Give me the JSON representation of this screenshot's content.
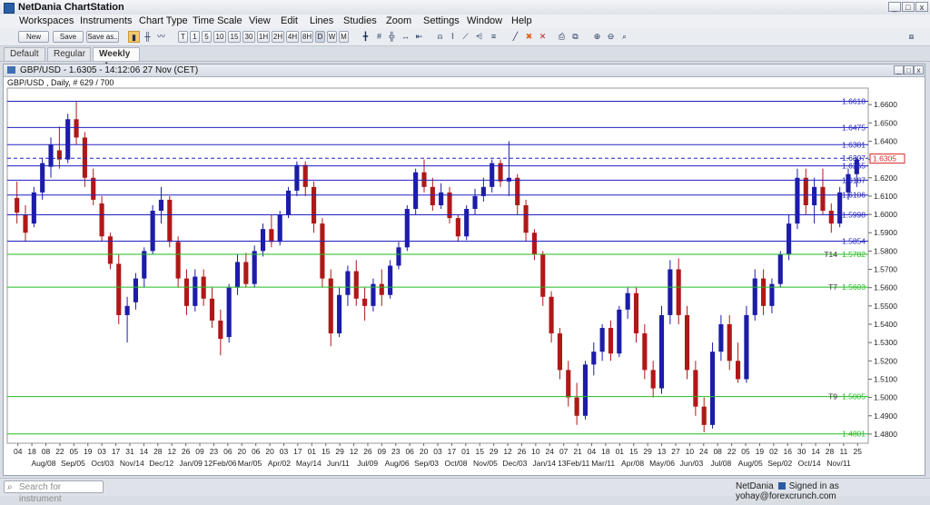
{
  "app": {
    "title": "NetDania ChartStation"
  },
  "window_buttons": [
    "_",
    "□",
    "x"
  ],
  "menu": [
    "Workspaces",
    "Instruments",
    "Chart Type",
    "Time Scale",
    "View",
    "Edit",
    "Lines",
    "Studies",
    "Zoom",
    "Settings",
    "Window",
    "Help"
  ],
  "toolbar": {
    "new_label": "New",
    "save_label": "Save",
    "save_as_label": "Save as..",
    "time_buttons": [
      "T",
      "1",
      "5",
      "10",
      "15",
      "30",
      "1H",
      "2H",
      "4H",
      "8H",
      "D",
      "W",
      "M"
    ]
  },
  "tabs": [
    {
      "label": "Default",
      "active": false
    },
    {
      "label": "Regular",
      "active": false
    },
    {
      "label": "Weekly",
      "active": true,
      "close": "✱"
    }
  ],
  "chart_window": {
    "title": "GBP/USD - 1.6305 - 14:12:06  27 Nov (CET)",
    "subtitle": "GBP/USD , Daily, # 629 / 700",
    "buttons": [
      "_",
      "□",
      "x"
    ]
  },
  "chart_data": {
    "type": "candlestick",
    "symbol": "GBP/USD",
    "interval": "Daily",
    "current_price": "1.6305",
    "current_price_color": "#d62828",
    "ylim": [
      1.475,
      1.669
    ],
    "y_ticks": [
      "1.6600",
      "1.6500",
      "1.6400",
      "1.6300",
      "1.6200",
      "1.6100",
      "1.6000",
      "1.5900",
      "1.5800",
      "1.5700",
      "1.5600",
      "1.5500",
      "1.5400",
      "1.5300",
      "1.5200",
      "1.5100",
      "1.5000",
      "1.4900",
      "1.4800"
    ],
    "x_ticks": [
      "04",
      "18",
      "08",
      "22",
      "05",
      "19",
      "03",
      "17",
      "31",
      "14",
      "28",
      "12",
      "26",
      "09",
      "23",
      "06",
      "20",
      "06",
      "20",
      "03",
      "17",
      "01",
      "15",
      "29",
      "12",
      "26",
      "09",
      "23",
      "06",
      "20",
      "03",
      "17",
      "01",
      "15",
      "29",
      "12",
      "26",
      "10",
      "24",
      "07",
      "21",
      "04",
      "18",
      "01",
      "15",
      "29",
      "13",
      "27",
      "10",
      "24",
      "08",
      "22",
      "05",
      "19",
      "02",
      "16",
      "30",
      "14",
      "28",
      "11",
      "25"
    ],
    "x_months": [
      "Aug/08",
      "Sep/05",
      "Oct/03",
      "Nov/14",
      "Dec/12",
      "Jan/09",
      "12Feb/06",
      "Mar/05",
      "Apr/02",
      "May/14",
      "Jun/11",
      "Jul/09",
      "Aug/06",
      "Sep/03",
      "Oct/08",
      "Nov/05",
      "Dec/03",
      "Jan/14",
      "13Feb/11",
      "Mar/11",
      "Apr/08",
      "May/06",
      "Jun/03",
      "Jul/08",
      "Aug/05",
      "Sep/02",
      "Oct/14",
      "Nov/11"
    ],
    "horizontal_lines": [
      {
        "value": 1.6618,
        "label": "1.6618",
        "color": "#2020c0",
        "style": "solid"
      },
      {
        "value": 1.6475,
        "label": "1.6475",
        "color": "#2020c0",
        "style": "solid"
      },
      {
        "value": 1.6381,
        "label": "1.6381",
        "color": "#2020c0",
        "style": "solid"
      },
      {
        "value": 1.6307,
        "label": "1.6307",
        "color": "#2020c0",
        "style": "dashed"
      },
      {
        "value": 1.6265,
        "label": "1.6265",
        "color": "#2020c0",
        "style": "solid"
      },
      {
        "value": 1.6187,
        "label": "1.6187",
        "color": "#2020c0",
        "style": "solid"
      },
      {
        "value": 1.6106,
        "label": "1.6106",
        "color": "#2020c0",
        "style": "solid"
      },
      {
        "value": 1.5998,
        "label": "1.5998",
        "color": "#2020c0",
        "style": "solid"
      },
      {
        "value": 1.5854,
        "label": "1.5854",
        "color": "#2020c0",
        "style": "solid"
      },
      {
        "value": 1.5782,
        "label": "1.5782",
        "name": "T14",
        "color": "#22bb22",
        "style": "solid"
      },
      {
        "value": 1.5603,
        "label": "1.5603",
        "name": "T7",
        "color": "#22bb22",
        "style": "solid"
      },
      {
        "value": 1.5005,
        "label": "1.5005",
        "name": "T9",
        "color": "#22bb22",
        "style": "solid"
      },
      {
        "value": 1.4801,
        "label": "1.4801",
        "color": "#22bb22",
        "style": "solid"
      }
    ],
    "up_color": "#1c1ca8",
    "down_color": "#b01818",
    "candles": [
      [
        1.609,
        1.618,
        1.595,
        1.601
      ],
      [
        1.6,
        1.605,
        1.585,
        1.59
      ],
      [
        1.595,
        1.615,
        1.593,
        1.612
      ],
      [
        1.612,
        1.631,
        1.608,
        1.628
      ],
      [
        1.626,
        1.642,
        1.62,
        1.638
      ],
      [
        1.635,
        1.648,
        1.625,
        1.63
      ],
      [
        1.63,
        1.655,
        1.628,
        1.652
      ],
      [
        1.652,
        1.662,
        1.638,
        1.642
      ],
      [
        1.642,
        1.645,
        1.615,
        1.62
      ],
      [
        1.62,
        1.625,
        1.605,
        1.608
      ],
      [
        1.606,
        1.61,
        1.585,
        1.588
      ],
      [
        1.588,
        1.59,
        1.57,
        1.573
      ],
      [
        1.573,
        1.578,
        1.54,
        1.545
      ],
      [
        1.545,
        1.555,
        1.53,
        1.55
      ],
      [
        1.552,
        1.568,
        1.548,
        1.565
      ],
      [
        1.565,
        1.582,
        1.56,
        1.58
      ],
      [
        1.58,
        1.605,
        1.578,
        1.602
      ],
      [
        1.602,
        1.615,
        1.595,
        1.608
      ],
      [
        1.608,
        1.61,
        1.582,
        1.585
      ],
      [
        1.585,
        1.588,
        1.56,
        1.565
      ],
      [
        1.565,
        1.57,
        1.545,
        1.55
      ],
      [
        1.55,
        1.57,
        1.547,
        1.566
      ],
      [
        1.566,
        1.57,
        1.55,
        1.554
      ],
      [
        1.554,
        1.56,
        1.538,
        1.542
      ],
      [
        1.542,
        1.548,
        1.523,
        1.532
      ],
      [
        1.533,
        1.562,
        1.53,
        1.56
      ],
      [
        1.56,
        1.578,
        1.556,
        1.574
      ],
      [
        1.574,
        1.579,
        1.56,
        1.562
      ],
      [
        1.562,
        1.583,
        1.56,
        1.58
      ],
      [
        1.58,
        1.595,
        1.577,
        1.592
      ],
      [
        1.592,
        1.6,
        1.582,
        1.585
      ],
      [
        1.585,
        1.602,
        1.583,
        1.6
      ],
      [
        1.6,
        1.615,
        1.598,
        1.613
      ],
      [
        1.613,
        1.629,
        1.61,
        1.627
      ],
      [
        1.627,
        1.629,
        1.61,
        1.615
      ],
      [
        1.615,
        1.618,
        1.59,
        1.595
      ],
      [
        1.595,
        1.598,
        1.56,
        1.565
      ],
      [
        1.565,
        1.57,
        1.528,
        1.535
      ],
      [
        1.535,
        1.56,
        1.533,
        1.556
      ],
      [
        1.556,
        1.572,
        1.55,
        1.569
      ],
      [
        1.569,
        1.575,
        1.55,
        1.554
      ],
      [
        1.554,
        1.56,
        1.542,
        1.55
      ],
      [
        1.55,
        1.565,
        1.547,
        1.562
      ],
      [
        1.562,
        1.57,
        1.55,
        1.556
      ],
      [
        1.556,
        1.575,
        1.554,
        1.572
      ],
      [
        1.572,
        1.585,
        1.57,
        1.582
      ],
      [
        1.582,
        1.605,
        1.58,
        1.603
      ],
      [
        1.603,
        1.625,
        1.6,
        1.623
      ],
      [
        1.623,
        1.63,
        1.612,
        1.615
      ],
      [
        1.615,
        1.62,
        1.602,
        1.605
      ],
      [
        1.605,
        1.617,
        1.603,
        1.612
      ],
      [
        1.612,
        1.615,
        1.595,
        1.598
      ],
      [
        1.598,
        1.6,
        1.585,
        1.588
      ],
      [
        1.588,
        1.605,
        1.586,
        1.603
      ],
      [
        1.603,
        1.614,
        1.6,
        1.61
      ],
      [
        1.61,
        1.62,
        1.607,
        1.615
      ],
      [
        1.615,
        1.63,
        1.612,
        1.628
      ],
      [
        1.628,
        1.63,
        1.615,
        1.618
      ],
      [
        1.618,
        1.64,
        1.61,
        1.62
      ],
      [
        1.62,
        1.622,
        1.6,
        1.605
      ],
      [
        1.605,
        1.608,
        1.585,
        1.59
      ],
      [
        1.59,
        1.592,
        1.575,
        1.578
      ],
      [
        1.578,
        1.58,
        1.55,
        1.555
      ],
      [
        1.555,
        1.558,
        1.53,
        1.535
      ],
      [
        1.535,
        1.538,
        1.51,
        1.515
      ],
      [
        1.515,
        1.52,
        1.495,
        1.5
      ],
      [
        1.5,
        1.508,
        1.485,
        1.49
      ],
      [
        1.49,
        1.52,
        1.488,
        1.518
      ],
      [
        1.518,
        1.53,
        1.512,
        1.525
      ],
      [
        1.525,
        1.54,
        1.52,
        1.538
      ],
      [
        1.538,
        1.542,
        1.52,
        1.524
      ],
      [
        1.524,
        1.55,
        1.522,
        1.548
      ],
      [
        1.548,
        1.56,
        1.543,
        1.557
      ],
      [
        1.557,
        1.56,
        1.53,
        1.535
      ],
      [
        1.535,
        1.54,
        1.51,
        1.515
      ],
      [
        1.515,
        1.52,
        1.5,
        1.505
      ],
      [
        1.505,
        1.55,
        1.502,
        1.545
      ],
      [
        1.545,
        1.575,
        1.54,
        1.57
      ],
      [
        1.57,
        1.576,
        1.54,
        1.545
      ],
      [
        1.545,
        1.55,
        1.51,
        1.515
      ],
      [
        1.515,
        1.52,
        1.49,
        1.495
      ],
      [
        1.495,
        1.5,
        1.481,
        1.485
      ],
      [
        1.485,
        1.53,
        1.483,
        1.525
      ],
      [
        1.525,
        1.545,
        1.52,
        1.54
      ],
      [
        1.54,
        1.545,
        1.515,
        1.52
      ],
      [
        1.52,
        1.53,
        1.508,
        1.51
      ],
      [
        1.51,
        1.55,
        1.508,
        1.545
      ],
      [
        1.545,
        1.57,
        1.542,
        1.565
      ],
      [
        1.565,
        1.57,
        1.545,
        1.55
      ],
      [
        1.55,
        1.565,
        1.546,
        1.562
      ],
      [
        1.562,
        1.58,
        1.56,
        1.578
      ],
      [
        1.578,
        1.6,
        1.575,
        1.595
      ],
      [
        1.595,
        1.625,
        1.592,
        1.62
      ],
      [
        1.62,
        1.625,
        1.6,
        1.605
      ],
      [
        1.605,
        1.62,
        1.595,
        1.615
      ],
      [
        1.615,
        1.625,
        1.6,
        1.602
      ],
      [
        1.602,
        1.606,
        1.59,
        1.595
      ],
      [
        1.595,
        1.615,
        1.593,
        1.612
      ],
      [
        1.612,
        1.625,
        1.608,
        1.622
      ],
      [
        1.622,
        1.631,
        1.615,
        1.63
      ]
    ]
  },
  "statusbar": {
    "search_placeholder": "Search for instrument",
    "brand": "NetDania",
    "signed_in": "Signed in as yohay@forexcrunch.com"
  }
}
